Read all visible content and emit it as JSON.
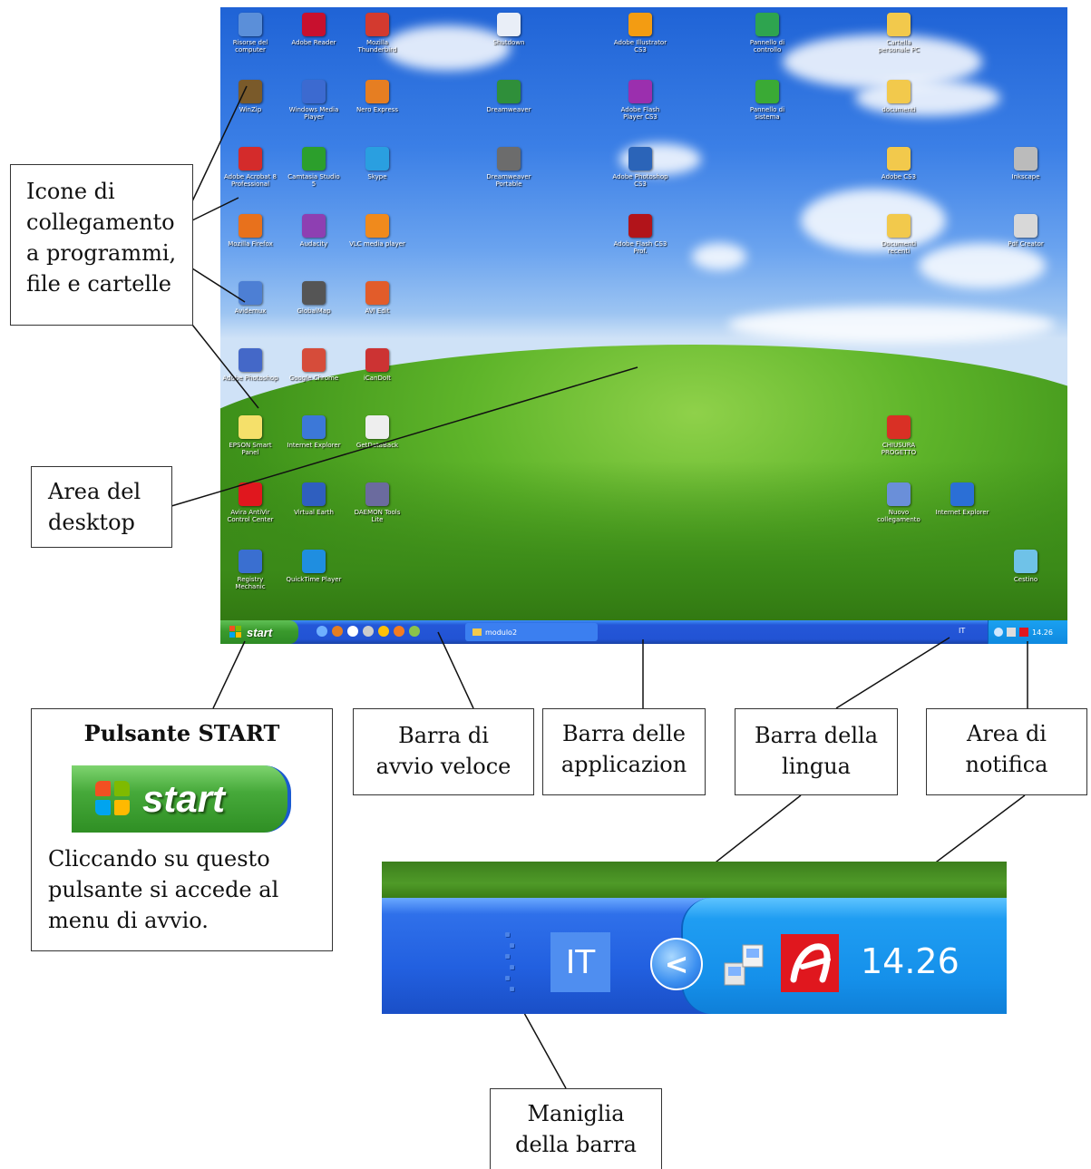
{
  "desktop": {
    "icons": [
      {
        "label": "Risorse del computer",
        "color": "#5b8fd9"
      },
      {
        "label": "Adobe Reader",
        "color": "#c8102e"
      },
      {
        "label": "Mozilla Thunderbird",
        "color": "#d33a2f"
      },
      {
        "label": "Shutdown",
        "color": "#e9eef7"
      },
      {
        "label": "Adobe Illustrator CS3",
        "color": "#f39c12"
      },
      {
        "label": "Pannello di controllo",
        "color": "#2ea44f"
      },
      {
        "label": "Cartella personale PC",
        "color": "#f2c94c"
      },
      {
        "label": "WinZip",
        "color": "#7a5a2a"
      },
      {
        "label": "Windows Media Player",
        "color": "#3c6ad0"
      },
      {
        "label": "Nero Express",
        "color": "#e67e22"
      },
      {
        "label": "Dreamweaver",
        "color": "#2f8f3a"
      },
      {
        "label": "Adobe Flash Player CS3",
        "color": "#9b2fae"
      },
      {
        "label": "Pannello di sistema",
        "color": "#3aaa35"
      },
      {
        "label": "documenti",
        "color": "#f2c94c"
      },
      {
        "label": "Adobe Acrobat 8 Professional",
        "color": "#d42b2b"
      },
      {
        "label": "Camtasia Studio 5",
        "color": "#2c9f2c"
      },
      {
        "label": "Skype",
        "color": "#2a9fe0"
      },
      {
        "label": "Dreamweaver Portable",
        "color": "#6c6c6c"
      },
      {
        "label": "Adobe Photoshop CS3",
        "color": "#2b64b8"
      },
      {
        "label": "Adobe CS3",
        "color": "#f2c94c"
      },
      {
        "label": "Inkscape",
        "color": "#bbbbbb"
      },
      {
        "label": "Mozilla Firefox",
        "color": "#e8711c"
      },
      {
        "label": "Audacity",
        "color": "#8e3fb2"
      },
      {
        "label": "VLC media player",
        "color": "#f08a1c"
      },
      {
        "label": "Adobe Flash CS3 Prof.",
        "color": "#b2141a"
      },
      {
        "label": "Documenti recenti",
        "color": "#f2c94c"
      },
      {
        "label": "Pdf Creator",
        "color": "#d8d8d8"
      },
      {
        "label": "Avidemux",
        "color": "#4d7fd4"
      },
      {
        "label": "GlobalMap",
        "color": "#555555"
      },
      {
        "label": "AVI Edit",
        "color": "#e25c2a"
      },
      {
        "label": "Adobe Photoshop",
        "color": "#4468c8"
      },
      {
        "label": "Google Chrome",
        "color": "#d64c3a"
      },
      {
        "label": "iCanDoIt",
        "color": "#cc3333"
      },
      {
        "label": "EPSON Smart Panel",
        "color": "#f5e06a"
      },
      {
        "label": "Internet Explorer",
        "color": "#3c78d8"
      },
      {
        "label": "GetDataBack",
        "color": "#eeeeee"
      },
      {
        "label": "CHIUSURA PROGETTO",
        "color": "#d93025"
      },
      {
        "label": "Avira AntiVir Control Center",
        "color": "#e0171e"
      },
      {
        "label": "Virtual Earth",
        "color": "#2f5fbf"
      },
      {
        "label": "DAEMON Tools Lite",
        "color": "#6b6b9e"
      },
      {
        "label": "Nuovo collegamento",
        "color": "#6a8fd9"
      },
      {
        "label": "Internet Explorer",
        "color": "#2b6fd6"
      },
      {
        "label": "Registry Mechanic",
        "color": "#3a6fd0"
      },
      {
        "label": "QuickTime Player",
        "color": "#1f8ee0"
      },
      {
        "label": "Cestino",
        "color": "#6fc2e8"
      }
    ],
    "taskbar": {
      "start_label": "start",
      "task_label": "modulo2",
      "lang": "IT",
      "time": "14.26"
    }
  },
  "callouts": {
    "icons": "Icone di collegamento a programmi, file e cartelle",
    "desktop_area": "Area del desktop",
    "start_title": "Pulsante START",
    "start_desc": "Cliccando su questo pulsante si accede al menu di avvio.",
    "quicklaunch": "Barra di avvio veloce",
    "apps": "Barra delle applicazion",
    "lang": "Barra della lingua",
    "notify": "Area di notifica",
    "handle": "Maniglia della barra"
  },
  "zoom": {
    "start_label": "start",
    "lang": "IT",
    "chevron": "<",
    "time": "14.26"
  },
  "colors": {
    "xp_blue": "#2253d4",
    "start_green": "#3a9a2d",
    "tray_blue": "#1590ea",
    "avira_red": "#e0171e"
  }
}
